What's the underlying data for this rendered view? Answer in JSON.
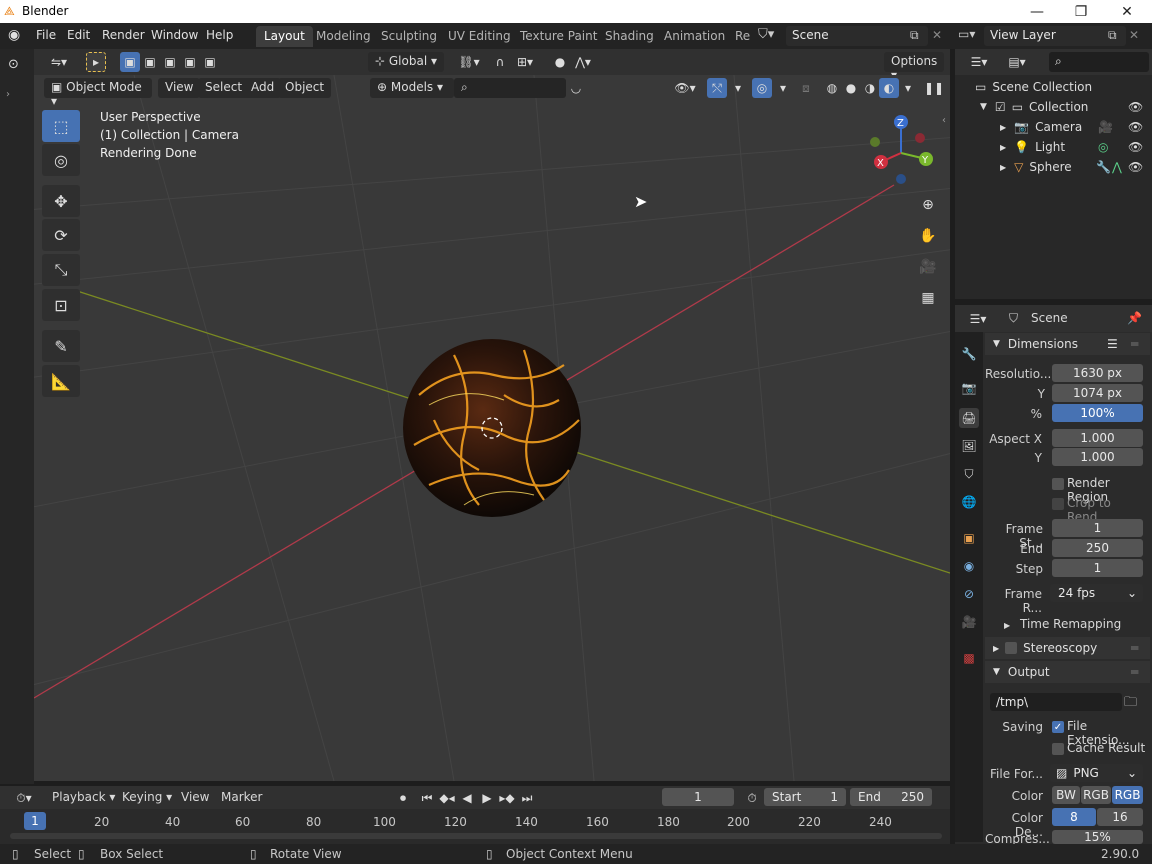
{
  "window": {
    "title": "Blender"
  },
  "menubar": {
    "items": [
      "File",
      "Edit",
      "Render",
      "Window",
      "Help"
    ],
    "workspaces": [
      "Layout",
      "Modeling",
      "Sculpting",
      "UV Editing",
      "Texture Paint",
      "Shading",
      "Animation",
      "Re"
    ],
    "active_workspace": "Layout",
    "scene_name": "Scene",
    "view_layer": "View Layer"
  },
  "toolheader": {
    "orientation": "Global",
    "options_label": "Options"
  },
  "viewport_header": {
    "mode": "Object Mode",
    "menus": [
      "View",
      "Select",
      "Add",
      "Object"
    ],
    "models_label": "Models"
  },
  "viewport_overlay": {
    "line1": "User Perspective",
    "line2": "(1) Collection | Camera",
    "line3": "Rendering Done"
  },
  "gizmo": {
    "x": "X",
    "y": "Y",
    "z": "Z"
  },
  "outliner": {
    "root": "Scene Collection",
    "collection": "Collection",
    "objects": [
      "Camera",
      "Light",
      "Sphere"
    ]
  },
  "properties": {
    "context": "Scene",
    "dimensions_title": "Dimensions",
    "res_label": "Resolutio...",
    "res_x": "1630 px",
    "y_label": "Y",
    "res_y": "1074 px",
    "pct_label": "%",
    "res_pct": "100%",
    "aspect_label": "Aspect X",
    "aspect_x": "1.000",
    "aspect_y": "1.000",
    "render_region": "Render Region",
    "crop": "Crop to Rend...",
    "frame_start_label": "Frame St...",
    "frame_start": "1",
    "end_label": "End",
    "frame_end": "250",
    "step_label": "Step",
    "frame_step": "1",
    "frame_rate_label": "Frame R...",
    "frame_rate": "24 fps",
    "time_remapping": "Time Remapping",
    "stereoscopy": "Stereoscopy",
    "output_title": "Output",
    "output_path": "/tmp\\",
    "saving_label": "Saving",
    "file_ext": "File Extensio...",
    "cache_result": "Cache Result",
    "file_format_label": "File For...",
    "file_format": "PNG",
    "color_label": "Color",
    "color_bw": "BW",
    "color_rgb": "RGB",
    "color_rgba": "RGB",
    "depth_label": "Color De...",
    "depth_8": "8",
    "depth_16": "16",
    "compress_label": "Compres...",
    "compress_val": "15%"
  },
  "timeline": {
    "menus": [
      "Playback",
      "Keying",
      "View",
      "Marker"
    ],
    "current_frame": "1",
    "start_label": "Start",
    "start": "1",
    "end_label": "End",
    "end": "250",
    "ticks": [
      "1",
      "20",
      "40",
      "60",
      "80",
      "100",
      "120",
      "140",
      "160",
      "180",
      "200",
      "220",
      "240"
    ]
  },
  "statusbar": {
    "select": "Select",
    "box_select": "Box Select",
    "rotate": "Rotate View",
    "context_menu": "Object Context Menu",
    "version": "2.90.0"
  }
}
